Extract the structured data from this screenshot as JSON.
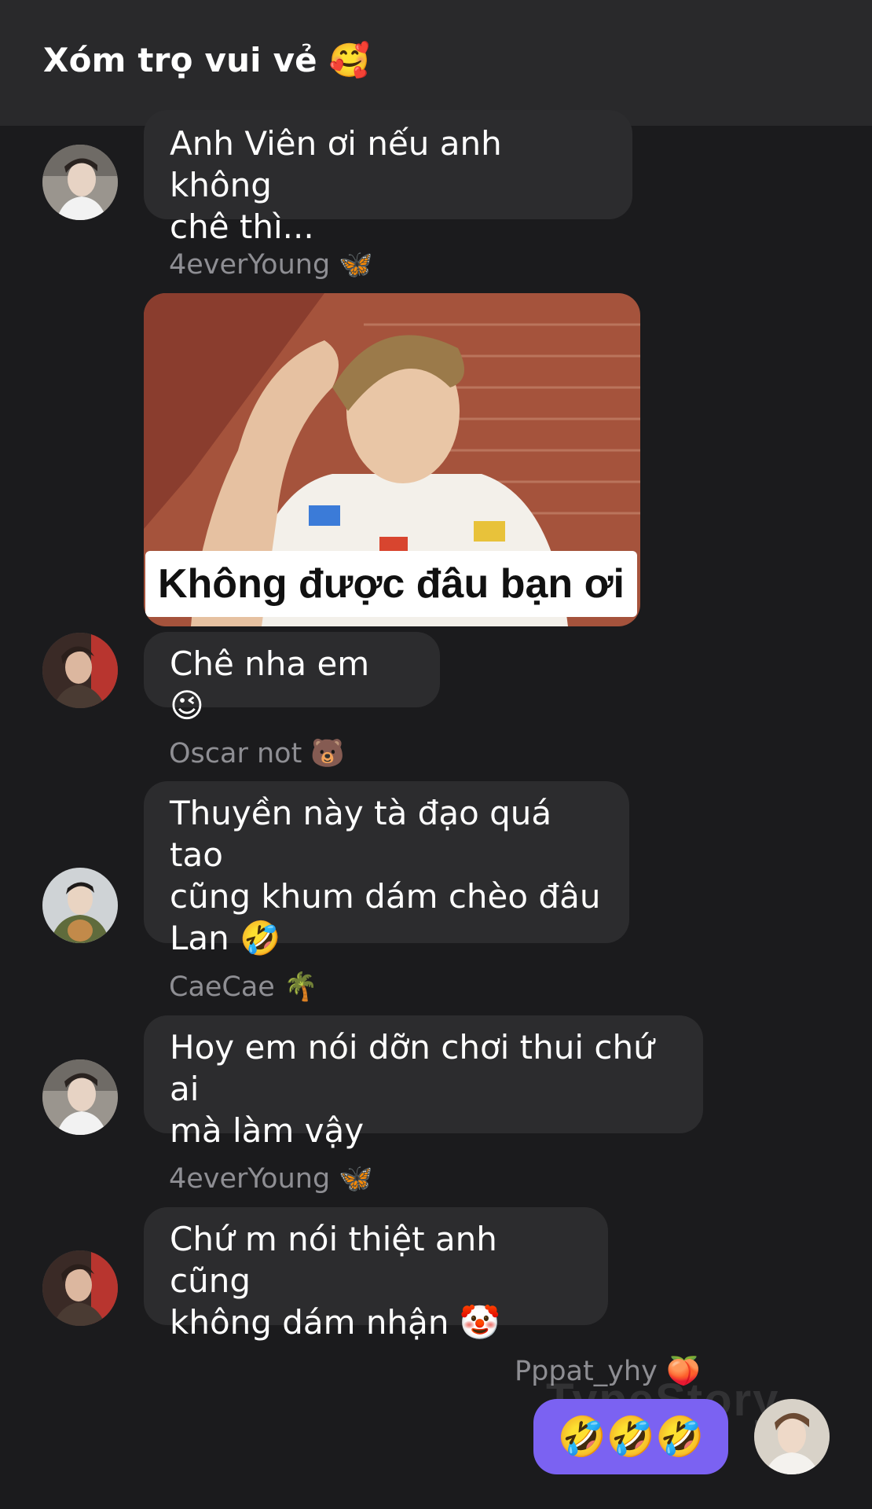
{
  "header": {
    "title": "Xóm trọ vui vẻ 🥰"
  },
  "messages": [
    {
      "sender": "",
      "text": "Anh Viên ơi nếu anh không\nchê thì..."
    },
    {
      "sender": "4everYoung 🦋",
      "meme_caption": "Không được đâu bạn ơi",
      "text": "Chê nha em 😉"
    },
    {
      "sender": "Oscar not 🐻",
      "text": "Thuyền này tà đạo quá tao\ncũng khum dám chèo đâu\nLan 🤣"
    },
    {
      "sender": "CaeCae 🌴",
      "text": "Hoy em nói dỡn chơi thui chứ ai\nmà làm vậy"
    },
    {
      "sender": "4everYoung 🦋",
      "text": "Chứ m nói thiệt anh cũng\nkhông dám nhận 🤡"
    }
  ],
  "my_message": {
    "sender": "Pppat_yhy 🍑",
    "text": "🤣🤣🤣"
  },
  "watermark": "TypeStory",
  "colors": {
    "background": "#1b1b1d",
    "header": "#29292b",
    "bubble": "#2c2c2e",
    "accent": "#7b62f2",
    "sender": "#8e8e93"
  }
}
